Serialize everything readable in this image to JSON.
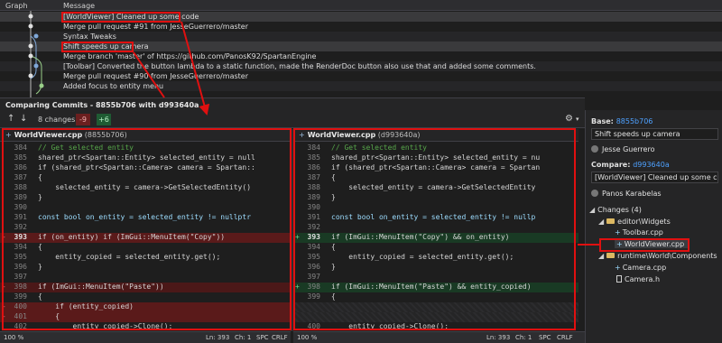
{
  "history": {
    "columns": {
      "graph": "Graph",
      "message": "Message"
    },
    "commits": [
      "[WorldViewer] Cleaned up some code",
      "Merge pull request #91 from JesseGuerrero/master",
      "Syntax Tweaks",
      "Shift speeds up camera",
      "Merge branch 'master' of https://github.com/PanosK92/SpartanEngine",
      "[Toolbar] Converted the button lambda to a static function, made the RenderDoc button also use that and added some comments.",
      "Merge pull request #90 from JesseGuerrero/master",
      "Added focus to entity menu"
    ]
  },
  "compare": {
    "title": "Comparing Commits - 8855b706 with d993640a",
    "changes_label": "8 changes",
    "deletions": "-9",
    "additions": "+6"
  },
  "left_pane": {
    "file": "WorldViewer.cpp",
    "hash": "(8855b706)",
    "lines": [
      {
        "n": "384",
        "text": "// Get selected entity"
      },
      {
        "n": "385",
        "text": "shared_ptr<Spartan::Entity> selected_entity = null"
      },
      {
        "n": "386",
        "text": "if (shared_ptr<Spartan::Camera> camera = Spartan::"
      },
      {
        "n": "387",
        "text": "{"
      },
      {
        "n": "388",
        "text": "    selected_entity = camera->GetSelectedEntity()"
      },
      {
        "n": "389",
        "text": "}"
      },
      {
        "n": "390",
        "text": ""
      },
      {
        "n": "391",
        "text": "const bool on_entity = selected_entity != nullptr"
      },
      {
        "n": "392",
        "text": ""
      },
      {
        "n": "393",
        "text": "if (on_entity) if (ImGui::MenuItem(\"Copy\"))"
      },
      {
        "n": "394",
        "text": "{"
      },
      {
        "n": "395",
        "text": "    entity_copied = selected_entity.get();"
      },
      {
        "n": "396",
        "text": "}"
      },
      {
        "n": "397",
        "text": ""
      },
      {
        "n": "398",
        "text": "if (ImGui::MenuItem(\"Paste\"))"
      },
      {
        "n": "399",
        "text": "{"
      },
      {
        "n": "400",
        "text": "    if (entity_copied)"
      },
      {
        "n": "401",
        "text": "    {"
      },
      {
        "n": "402",
        "text": "        entity_copied->Clone();"
      }
    ]
  },
  "right_pane": {
    "file": "WorldViewer.cpp",
    "hash": "(d993640a)",
    "lines": [
      {
        "n": "384",
        "text": "// Get selected entity"
      },
      {
        "n": "385",
        "text": "shared_ptr<Spartan::Entity> selected_entity = nu"
      },
      {
        "n": "386",
        "text": "if (shared_ptr<Spartan::Camera> camera = Spartan"
      },
      {
        "n": "387",
        "text": "{"
      },
      {
        "n": "388",
        "text": "    selected_entity = camera->GetSelectedEntity"
      },
      {
        "n": "389",
        "text": "}"
      },
      {
        "n": "390",
        "text": ""
      },
      {
        "n": "391",
        "text": "const bool on_entity = selected_entity != nullp"
      },
      {
        "n": "392",
        "text": ""
      },
      {
        "n": "393",
        "text": "if (ImGui::MenuItem(\"Copy\") && on_entity)"
      },
      {
        "n": "394",
        "text": "{"
      },
      {
        "n": "395",
        "text": "    entity_copied = selected_entity.get();"
      },
      {
        "n": "396",
        "text": "}"
      },
      {
        "n": "397",
        "text": ""
      },
      {
        "n": "398",
        "text": "if (ImGui::MenuItem(\"Paste\") && entity_copied)"
      },
      {
        "n": "399",
        "text": "{"
      },
      {
        "n": "",
        "text": ""
      },
      {
        "n": "",
        "text": ""
      },
      {
        "n": "400",
        "text": "    entity_copied->Clone();"
      }
    ]
  },
  "status_left": {
    "zoom": "100 %",
    "ln": "Ln: 393",
    "ch": "Ch: 1",
    "spc": "SPC",
    "crlf": "CRLF"
  },
  "status_right": {
    "zoom": "100 %",
    "ln": "Ln: 393",
    "ch": "Ch: 1",
    "spc": "SPC",
    "crlf": "CRLF"
  },
  "sidebar": {
    "base_label": "Base:",
    "base_hash": "8855b706",
    "base_message": "Shift speeds up camera",
    "base_author": "Jesse Guerrero",
    "compare_label": "Compare:",
    "compare_hash": "d993640a",
    "compare_message": "[WorldViewer] Cleaned up some code",
    "compare_author": "Panos Karabelas",
    "changes_label": "Changes (4)",
    "folder1": "editor\\Widgets",
    "file1": "Toolbar.cpp",
    "file2": "WorldViewer.cpp",
    "folder2": "runtime\\World\\Components",
    "file3": "Camera.cpp",
    "file4": "Camera.h"
  },
  "colors": {
    "annotation": "#e01010",
    "deleted": "#4b1818",
    "added": "#193a24",
    "link": "#4ea1ff"
  }
}
